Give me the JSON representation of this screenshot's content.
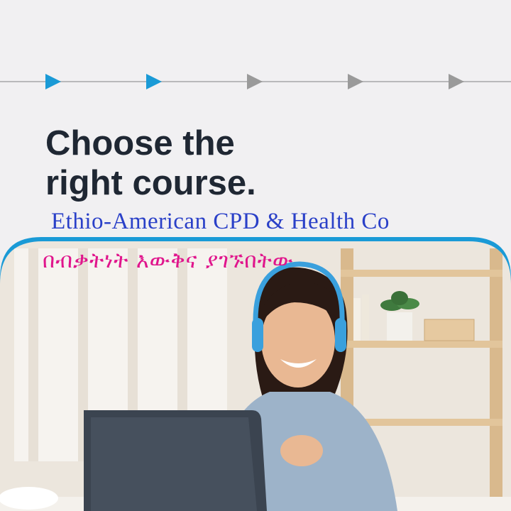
{
  "progress_steps": [
    {
      "state": "active",
      "color": "#1a9ad6"
    },
    {
      "state": "active",
      "color": "#1a9ad6"
    },
    {
      "state": "inactive",
      "color": "#9a9a9a"
    },
    {
      "state": "inactive",
      "color": "#9a9a9a"
    },
    {
      "state": "inactive",
      "color": "#9a9a9a"
    }
  ],
  "headline": {
    "line1": "Choose the",
    "line2": "right course."
  },
  "company_name": "Ethio-American CPD & Health Co",
  "amharic_tagline": "በብቃትነት እውቅና ያገኙበትው",
  "colors": {
    "accent": "#1a9ad6",
    "company_text": "#2a40c8",
    "tagline_text": "#e0158c",
    "headline_text": "#1f2733"
  }
}
